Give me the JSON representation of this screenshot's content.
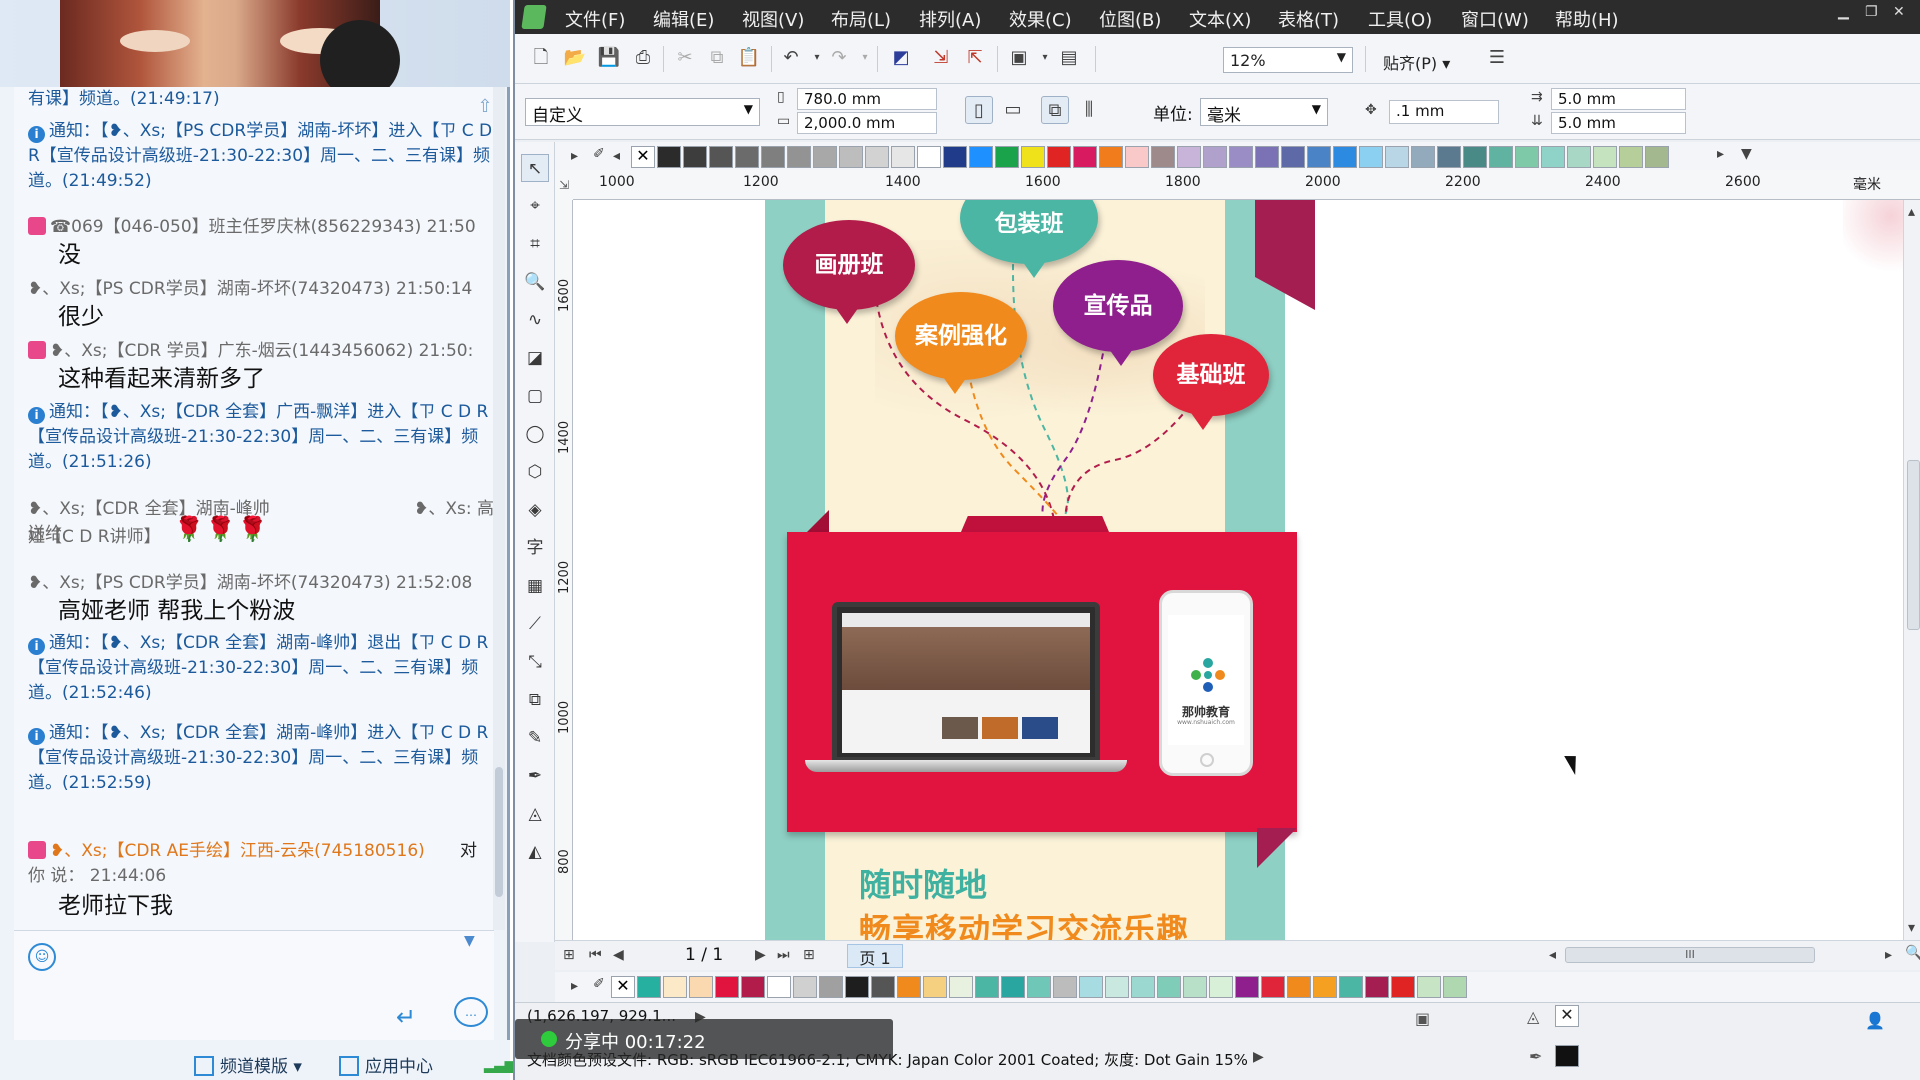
{
  "chat": {
    "messages": [
      {
        "text": "有课】频道。(21:49:17)"
      },
      {
        "text": "通知：【❥、Xs;【PS CDR学员】湖南-坏坏】进入【ㄗ C D R【宣传品设计高级班-21:30-22:30】周一、二、三有课】频道。(21:49:52)"
      },
      {
        "text": "☎069【046-050】班主任罗庆林(856229343) 21:50"
      },
      {
        "text": "没"
      },
      {
        "text": "❥、Xs;【PS CDR学员】湖南-坏坏(74320473) 21:50:14"
      },
      {
        "text": "很少"
      },
      {
        "text": "❥、Xs;【CDR 学员】广东-烟云(1443456062) 21:50:"
      },
      {
        "text": "这种看起来清新多了"
      },
      {
        "text": "通知：【❥、Xs;【CDR 全套】广西-飘洋】进入【ㄗ C D R【宣传品设计高级班-21:30-22:30】周一、二、三有课】频道。(21:51:26)"
      },
      {
        "text": "❥、Xs;【CDR 全套】湖南-峰帅 送给"
      },
      {
        "text": "❥、Xs: 高"
      },
      {
        "text": "娅【C D R讲师】"
      },
      {
        "text": "🌹🌹🌹"
      },
      {
        "text": "❥、Xs;【PS CDR学员】湖南-坏坏(74320473) 21:52:08"
      },
      {
        "text": "高娅老师    帮我上个粉波"
      },
      {
        "text": "通知：【❥、Xs;【CDR 全套】湖南-峰帅】退出【ㄗ C D R【宣传品设计高级班-21:30-22:30】周一、二、三有课】频道。(21:52:46)"
      },
      {
        "text": "通知：【❥、Xs;【CDR 全套】湖南-峰帅】进入【ㄗ C D R【宣传品设计高级班-21:30-22:30】周一、二、三有课】频道。(21:52:59)"
      },
      {
        "text": "❥、Xs;【CDR AE手绘】江西-云朵(745180516)"
      },
      {
        "text": "对"
      },
      {
        "text": "你 说： 21:44:06"
      },
      {
        "text": "老师拉下我"
      }
    ],
    "footer": {
      "template_label": "频道模版",
      "app_center_label": "应用中心"
    }
  },
  "cdr": {
    "menus": [
      "文件(F)",
      "编辑(E)",
      "视图(V)",
      "布局(L)",
      "排列(A)",
      "效果(C)",
      "位图(B)",
      "文本(X)",
      "表格(T)",
      "工具(O)",
      "窗口(W)",
      "帮助(H)"
    ],
    "zoom": "12%",
    "snap": "贴齐(P)",
    "page_size_preset": "自定义",
    "width": "780.0 mm",
    "height": "2,000.0 mm",
    "unit_label": "单位:",
    "unit": "毫米",
    "nudge": ".1 mm",
    "dup_x": "5.0 mm",
    "dup_y": "5.0 mm",
    "ruler_h": [
      "1000",
      "1200",
      "1400",
      "1600",
      "1800",
      "2000",
      "2200",
      "2400",
      "2600",
      "毫米"
    ],
    "ruler_v": [
      "1600",
      "1400",
      "1200",
      "1000",
      "800"
    ],
    "page_counter": "1 / 1",
    "page_tab": "页 1",
    "hscroll_thumb_label": "III",
    "status_coords": "(1,626.197, 929.1...",
    "status_profile": "文档颜色预设文件: RGB: sRGB IEC61966-2.1; CMYK: Japan Color 2001 Coated; 灰度: Dot Gain 15%",
    "share_label": "分享中 00:17:22"
  },
  "design": {
    "bubbles": [
      "包装班",
      "画册班",
      "案例强化",
      "宣传品",
      "基础班"
    ],
    "phone_brand": "那帅教育",
    "phone_url": "www.nshuaich.com",
    "headline1": "随时随地",
    "headline2": "畅享移动学习交流乐趣"
  },
  "colors": {
    "folder_red": "#e0143f",
    "teal": "#8fd0c4",
    "cream": "#fbf2d8",
    "orange": "#f08a1c",
    "headline_teal": "#3fb1a0",
    "menubar": "#2c2c2c"
  },
  "icons": {
    "info": "info-circle-icon",
    "gift": "gift-icon",
    "emoji": "emoji-icon",
    "send": "send-arrow-icon",
    "pointer": "pick-tool-icon"
  }
}
